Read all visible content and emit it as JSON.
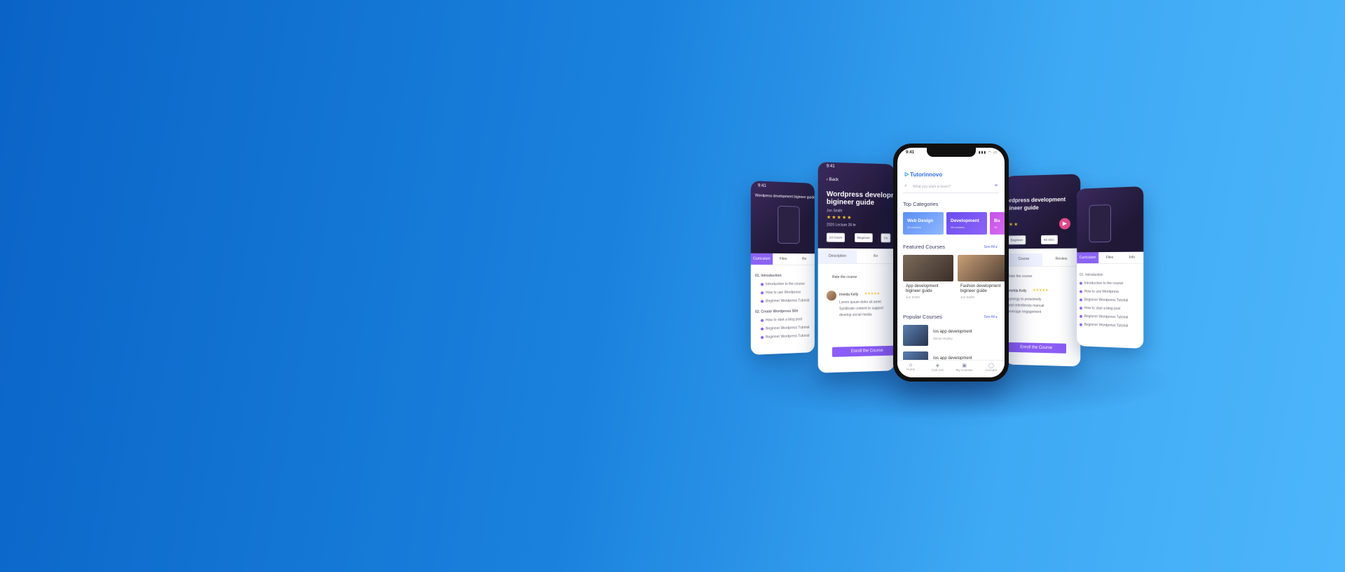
{
  "colors": {
    "bg_left": "#0a64c7",
    "bg_right": "#4db6fb",
    "accent": "#8b5cf6",
    "header_dark": "#2a1f48"
  },
  "far_left": {
    "time": "9:41",
    "header": "Wordpress development bigineer guide",
    "tabs": [
      "Curriculum",
      "Files",
      "Re"
    ],
    "lines": [
      "01. Introduction",
      "Introduction to the course",
      "How to use Wordpress",
      "Beginner Wordpress Tutorial",
      "02. Create Wordpress Site",
      "How to start a blog post",
      "Beginner Wordpress Tutorial",
      "Beginner Wordpress Tutorial"
    ]
  },
  "left_detail": {
    "time": "9:41",
    "back": "Back",
    "title": "Wordpress development bigineer guide",
    "author": "Jon Smith",
    "stars": "★★★★★",
    "meta": "2020 Lecture 26 hr",
    "chips": [
      "24 Hours",
      "Beginner",
      "Ce"
    ],
    "tabs": [
      "Description",
      "Re"
    ],
    "rate_label": "Rate the course",
    "reviewer": "Imelda Kelly",
    "review_stars": "★★★★★",
    "review_lines": [
      "Lorem ipsum dolor sit amet",
      "Syndicate content to support",
      "develop social media"
    ],
    "cta": "Enroll the Course"
  },
  "main": {
    "time": "9:41",
    "status_icons": "▮▮▮ ◠ ▭",
    "logo_mark": "ᐅ",
    "logo": "Tutorinnovo",
    "search_icon": "⌕",
    "search_placeholder": "What you want to learn?",
    "filter_icon": "≡",
    "top_categories": "Top Categories",
    "categories": [
      {
        "name": "Web Design",
        "count": "34 courses"
      },
      {
        "name": "Development",
        "count": "48 courses"
      },
      {
        "name": "Bu",
        "count": "26"
      }
    ],
    "featured_title": "Featured Courses",
    "see_all": "See All ▸",
    "featured": [
      {
        "name": "App development bigineer guide",
        "author": "Jon Smith"
      },
      {
        "name": "Fashion development bigineer guide",
        "author": "Jon Smith"
      }
    ],
    "popular_title": "Popular Courses",
    "popular": [
      {
        "name": "Ios app development",
        "author": "Simon Huxley"
      },
      {
        "name": "Ios app development",
        "author": ""
      }
    ],
    "nav": [
      {
        "icon": "⌂",
        "label": "Home"
      },
      {
        "icon": "◈",
        "label": "Cart List"
      },
      {
        "icon": "▣",
        "label": "My Courses"
      },
      {
        "icon": "◯",
        "label": "Account"
      }
    ]
  },
  "right_detail": {
    "title": "Wordpress development bigineer guide",
    "stars": "★★★",
    "chips": [
      "Beginner",
      "93 4GC"
    ],
    "tabs": [
      "Course",
      "Review"
    ],
    "rate_label": "Rate the course",
    "reviewer": "Imelda Kelly",
    "review_stars": "★★★★★",
    "review_lines": [
      "synergy to proactively",
      "and relentlessly manual",
      "leverage engagement"
    ],
    "cta": "Enroll the Course"
  },
  "far_right": {
    "tabs": [
      "Curriculum",
      "Files",
      "Info"
    ],
    "lines": [
      "01. Introduction",
      "Introduction to the course",
      "How to use Wordpress",
      "Beginner Wordpress Tutorial",
      "How to start a blog post",
      "Beginner Wordpress Tutorial",
      "Beginner Wordpress Tutorial"
    ]
  }
}
